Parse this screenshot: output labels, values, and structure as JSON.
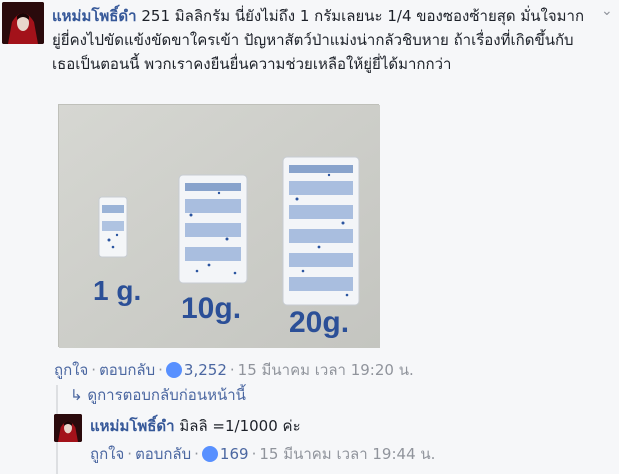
{
  "comment": {
    "author": "แหม่มโพธิ์ดำ",
    "text": "251 มิลลิกรัม นี่ยังไม่ถึง 1 กรัมเลยนะ 1/4 ของซองซ้ายสุด มั่นใจมาก ยู่ยี่คงไปขัดแข้งขัดขาใครเข้า ปัญหาสัตว์ป่าแม่งน่ากลัวชิบหาย ถ้าเรื่องที่เกิดขึ้นกับเธอเป็นตอนนี้ พวกเราคงยืนยื่นความช่วยเหลือให้ยู่ยี่ได้มากกว่า",
    "like_label": "ถูกใจ",
    "reply_label": "ตอบกลับ",
    "like_count": "3,252",
    "timestamp": "15 มีนาคม เวลา 19:20 น."
  },
  "photo": {
    "labels": [
      "1 g.",
      "10g.",
      "20g."
    ]
  },
  "previous_replies": {
    "label": "ดูการตอบกลับก่อนหน้านี้"
  },
  "reply": {
    "author": "แหม่มโพธิ์ดำ",
    "text": "มิลลิ =1/1000 ค่ะ",
    "like_label": "ถูกใจ",
    "reply_label": "ตอบกลับ",
    "like_count": "169",
    "timestamp": "15 มีนาคม เวลา 19:44 น."
  },
  "colors": {
    "author": "#365899",
    "link": "#4b67a1",
    "muted": "#90949c",
    "like_badge": "#5890ff",
    "background": "#f6f7f9"
  },
  "icons": [
    "avatar",
    "chevron-down-icon",
    "like-icon",
    "reply-arrow-icon"
  ]
}
